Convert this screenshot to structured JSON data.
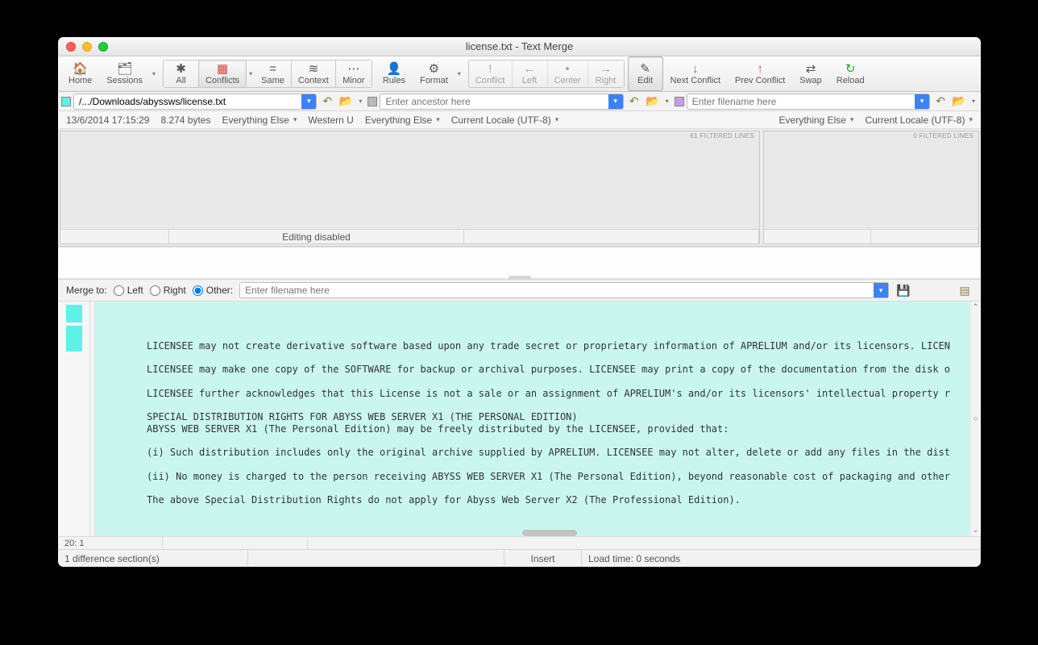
{
  "window_title": "license.txt - Text Merge",
  "toolbar": {
    "home": "Home",
    "sessions": "Sessions",
    "all": "All",
    "conflicts": "Conflicts",
    "same": "Same",
    "context": "Context",
    "minor": "Minor",
    "rules": "Rules",
    "format": "Format",
    "conflict": "Conflict",
    "left": "Left",
    "center": "Center",
    "right": "Right",
    "edit": "Edit",
    "next_conflict": "Next Conflict",
    "prev_conflict": "Prev Conflict",
    "swap": "Swap",
    "reload": "Reload"
  },
  "paths": {
    "left_value": "/.../Downloads/abyssws/license.txt",
    "center_placeholder": "Enter ancestor here",
    "right_placeholder": "Enter filename here"
  },
  "info": {
    "timestamp": "13/6/2014 17:15:29",
    "filesize": "8.274 bytes",
    "everything_else": "Everything Else",
    "encoding_left": "Western U",
    "current_locale": "Current Locale (UTF-8)"
  },
  "panes": {
    "left_filtered": "61 FILTERED LINES",
    "right_filtered": "0 FILTERED LINES",
    "editing_disabled": "Editing disabled"
  },
  "merge": {
    "label": "Merge to:",
    "left": "Left",
    "right": "Right",
    "other": "Other:",
    "other_placeholder": "Enter filename here"
  },
  "content_lines": [
    "",
    "LICENSEE may not create derivative software based upon any trade secret or proprietary information of APRELIUM and/or its licensors. LICEN",
    "",
    "LICENSEE may make one copy of the SOFTWARE for backup or archival purposes. LICENSEE may print a copy of the documentation from the disk o",
    "",
    "LICENSEE further acknowledges that this License is not a sale or an assignment of APRELIUM's and/or its licensors' intellectual property r",
    "",
    "SPECIAL DISTRIBUTION RIGHTS FOR ABYSS WEB SERVER X1 (THE PERSONAL EDITION)",
    "ABYSS WEB SERVER X1 (The Personal Edition) may be freely distributed by the LICENSEE, provided that:",
    "",
    "(i) Such distribution includes only the original archive supplied by APRELIUM. LICENSEE may not alter, delete or add any files in the dist",
    "",
    "(ii) No money is charged to the person receiving ABYSS WEB SERVER X1 (The Personal Edition), beyond reasonable cost of packaging and other ",
    "",
    "The above Special Distribution Rights do not apply for Abyss Web Server X2 (The Professional Edition)."
  ],
  "position": "20: 1",
  "status": {
    "diff_sections": "1 difference section(s)",
    "insert": "Insert",
    "load_time": "Load time: 0 seconds"
  }
}
